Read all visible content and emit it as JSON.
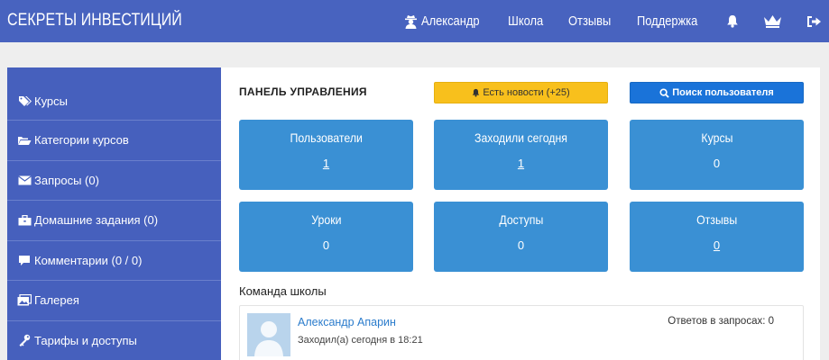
{
  "header": {
    "brand": "СЕКРЕТЫ ИНВЕСТИЦИЙ",
    "user_name": "Александр",
    "nav": [
      "Школа",
      "Отзывы",
      "Поддержка"
    ],
    "icons": [
      "user-secret-icon",
      "bell-icon",
      "crown-icon",
      "sign-out-icon"
    ]
  },
  "sidebar": {
    "items": [
      {
        "label": "Курсы",
        "icon": "tags-icon"
      },
      {
        "label": "Категории курсов",
        "icon": "folder-open-icon"
      },
      {
        "label": "Запросы (0)",
        "icon": "envelope-icon"
      },
      {
        "label": "Домашние задания (0)",
        "icon": "briefcase-icon"
      },
      {
        "label": "Комментарии (0 / 0)",
        "icon": "comment-icon"
      },
      {
        "label": "Галерея",
        "icon": "image-icon"
      },
      {
        "label": "Тарифы и доступы",
        "icon": "key-icon"
      }
    ]
  },
  "main": {
    "title": "ПАНЕЛЬ УПРАВЛЕНИЯ",
    "news_button": "Есть новости (+25)",
    "search_button": "Поиск пользователя",
    "tiles": [
      {
        "title": "Пользователи",
        "value": "1"
      },
      {
        "title": "Заходили сегодня",
        "value": "1"
      },
      {
        "title": "Курсы",
        "value": "0"
      },
      {
        "title": "Уроки",
        "value": "0"
      },
      {
        "title": "Доступы",
        "value": "0"
      },
      {
        "title": "Отзывы",
        "value": "0"
      }
    ],
    "team": {
      "title": "Команда школы",
      "member": {
        "name": "Александр Апарин",
        "status": "Заходил(а) сегодня в 18:21",
        "answers": "Ответов в запросах: 0"
      }
    }
  },
  "colors": {
    "header_bg": "#4863bf",
    "sidebar_bg": "#4660bd",
    "tile_bg": "#3a90d4",
    "news_btn": "#f8c01c",
    "search_btn": "#1a73d9",
    "link": "#2b7ccc"
  }
}
